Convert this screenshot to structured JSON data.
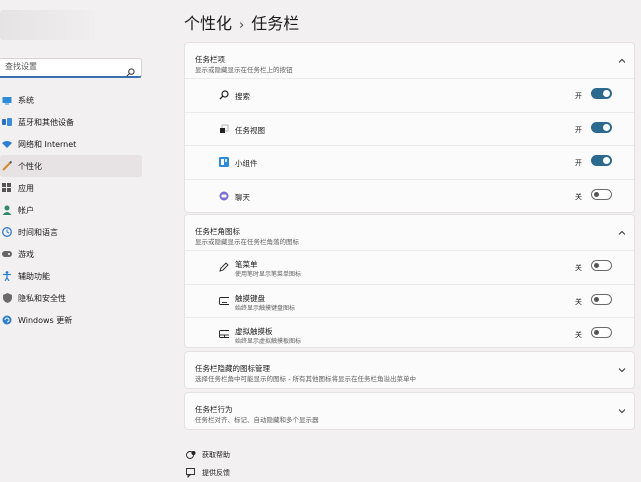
{
  "sidebar": {
    "search_placeholder": "查找设置",
    "items": [
      {
        "label": "系统",
        "icon": "monitor-icon"
      },
      {
        "label": "蓝牙和其他设备",
        "icon": "bluetooth-icon"
      },
      {
        "label": "网络和 Internet",
        "icon": "wifi-icon"
      },
      {
        "label": "个性化",
        "icon": "pencil-icon",
        "active": true
      },
      {
        "label": "应用",
        "icon": "apps-icon"
      },
      {
        "label": "帐户",
        "icon": "person-icon"
      },
      {
        "label": "时间和语言",
        "icon": "globe-clock-icon"
      },
      {
        "label": "游戏",
        "icon": "gamepad-icon"
      },
      {
        "label": "辅助功能",
        "icon": "accessibility-icon"
      },
      {
        "label": "隐私和安全性",
        "icon": "shield-icon"
      },
      {
        "label": "Windows 更新",
        "icon": "update-icon"
      }
    ]
  },
  "breadcrumb": {
    "parent": "个性化",
    "separator": "›",
    "current": "任务栏"
  },
  "taskbar_items": {
    "title": "任务栏项",
    "subtitle": "显示或隐藏显示在任务栏上的按钮",
    "rows": [
      {
        "label": "搜索",
        "state": "开",
        "on": true,
        "icon": "search-icon"
      },
      {
        "label": "任务视图",
        "state": "开",
        "on": true,
        "icon": "task-view-icon"
      },
      {
        "label": "小组件",
        "state": "开",
        "on": true,
        "icon": "widgets-icon"
      },
      {
        "label": "聊天",
        "state": "关",
        "on": false,
        "icon": "chat-icon"
      }
    ]
  },
  "corner_icons": {
    "title": "任务栏角图标",
    "subtitle": "显示或隐藏显示在任务栏角落的图标",
    "rows": [
      {
        "label": "笔菜单",
        "desc": "使用笔时显示笔菜单图标",
        "state": "关",
        "on": false,
        "icon": "pen-icon"
      },
      {
        "label": "触摸键盘",
        "desc": "始终显示触摸键盘图标",
        "state": "关",
        "on": false,
        "icon": "keyboard-icon"
      },
      {
        "label": "虚拟触摸板",
        "desc": "始终显示虚拟触摸板图标",
        "state": "关",
        "on": false,
        "icon": "touchpad-icon"
      }
    ]
  },
  "overflow": {
    "title": "任务栏隐藏的图标管理",
    "subtitle": "选择任务栏角中可能显示的图标 - 所有其他图标将显示在任务栏角溢出菜单中"
  },
  "behaviors": {
    "title": "任务栏行为",
    "subtitle": "任务栏对齐、标记、自动隐藏和多个显示器"
  },
  "links": {
    "help": "获取帮助",
    "feedback": "提供反馈"
  },
  "colors": {
    "accent": "#2b6a8e",
    "background": "#f3f0f1",
    "card": "#fbfbfb"
  }
}
